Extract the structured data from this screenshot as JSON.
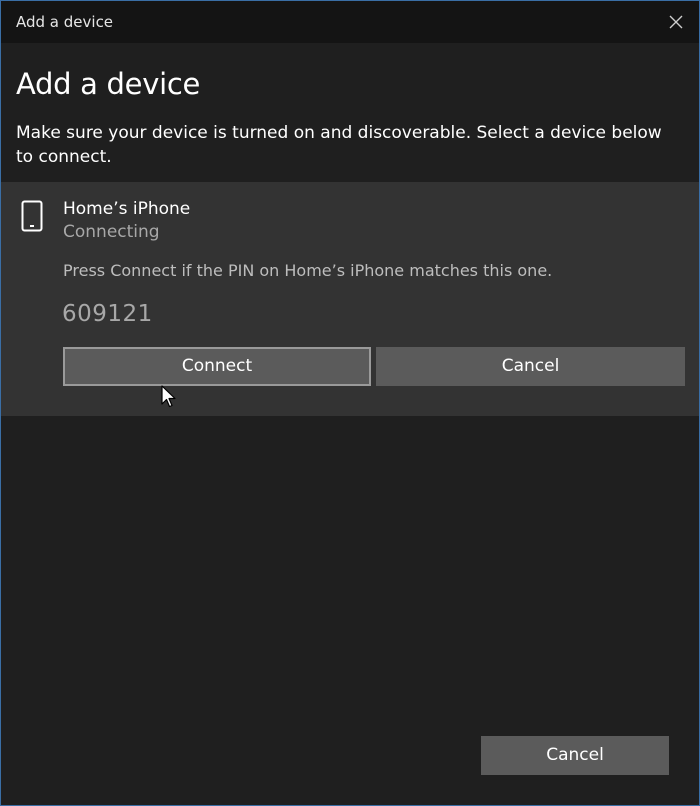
{
  "window": {
    "title": "Add a device"
  },
  "dialog": {
    "heading": "Add a device",
    "instructions": "Make sure your device is turned on and discoverable. Select a device below to connect."
  },
  "device": {
    "icon": "phone-icon",
    "name": "Home’s iPhone",
    "status": "Connecting",
    "pin_prompt": "Press Connect if the PIN on Home’s iPhone matches this one.",
    "pin": "609121",
    "connect_label": "Connect",
    "cancel_label": "Cancel"
  },
  "footer": {
    "cancel_label": "Cancel"
  },
  "colors": {
    "titlebar_bg": "#141414",
    "window_bg": "#1f1f1f",
    "panel_bg": "#333333",
    "button_bg": "#5b5b5b",
    "window_border": "#3a6ea5"
  }
}
